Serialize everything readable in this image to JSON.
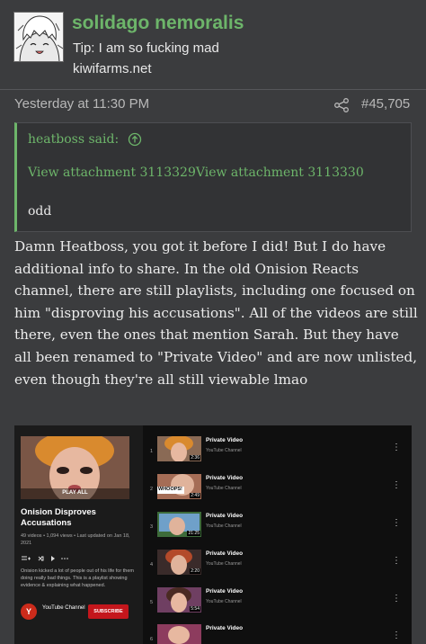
{
  "author": {
    "username": "solidago nemoralis",
    "title": "Tip: I am so fucking mad",
    "site": "kiwifarms.net"
  },
  "post": {
    "date": "Yesterday at 11:30 PM",
    "number": "#45,705",
    "body": "Damn Heatboss, you got it before I did! But I do have additional info to share. In the old Onision Reacts channel, there are still playlists, including one focused on him \"disproving his accusations\". All of the videos are still there, even the ones that mention Sarah. But they have all been renamed to \"Private Video\" and are now unlisted, even though they're all still viewable lmao"
  },
  "quote": {
    "author_line": "heatboss said:",
    "attachments": "View attachment 3113329View attachment 3113330",
    "text": "odd"
  },
  "embed": {
    "playlist": {
      "play_all": "PLAY ALL",
      "title": "Onision Disproves Accusations",
      "meta": "49 videos • 1,094 views • Last updated on Jan 18, 2021",
      "description": "Onision kicked a lot of people out of his life for them doing really bad things. This is a playlist showing evidence & explaining what happened.",
      "channel_logo": "Y",
      "channel_name": "YouTube Channel",
      "subscribe": "SUBSCRIBE"
    },
    "videos": [
      {
        "num": "1",
        "title": "Private Video",
        "channel": "YouTube Channel",
        "duration": "2:36"
      },
      {
        "num": "2",
        "title": "Private Video",
        "channel": "YouTube Channel",
        "duration": "2:49",
        "overlay": "WHOOPS!"
      },
      {
        "num": "3",
        "title": "Private Video",
        "channel": "YouTube Channel",
        "duration": "21:25"
      },
      {
        "num": "4",
        "title": "Private Video",
        "channel": "YouTube Channel",
        "duration": "2:20"
      },
      {
        "num": "5",
        "title": "Private Video",
        "channel": "YouTube Channel",
        "duration": "5:54"
      },
      {
        "num": "6",
        "title": "Private Video",
        "channel": "YouTube Channel",
        "duration": ""
      }
    ]
  },
  "icons": {
    "share": "share-icon",
    "quote_jump": "arrow-up-circle-icon",
    "menu": "vertical-dots-icon"
  },
  "colors": {
    "accent": "#6db56a",
    "background": "#3b3c3e",
    "subscribe": "#c4161c"
  }
}
